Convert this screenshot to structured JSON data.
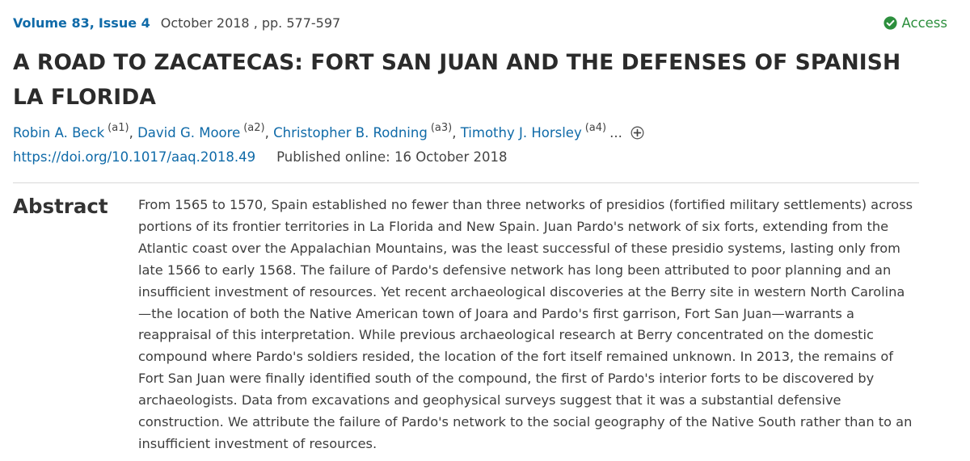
{
  "issue": {
    "volume": "Volume 83",
    "separator": ",",
    "issue": "Issue 4",
    "date_pages": "October 2018 , pp. 577-597"
  },
  "access": {
    "label": "Access",
    "icon": "check-circle-icon",
    "color": "#2c8f3d"
  },
  "article": {
    "title": "A ROAD TO ZACATECAS: FORT SAN JUAN AND THE DEFENSES OF SPANISH LA FLORIDA"
  },
  "authors": [
    {
      "name": "Robin A. Beck",
      "aff": "(a1)"
    },
    {
      "name": "David G. Moore",
      "aff": "(a2)"
    },
    {
      "name": "Christopher B. Rodning",
      "aff": "(a3)"
    },
    {
      "name": "Timothy J. Horsley",
      "aff": "(a4)"
    }
  ],
  "authors_more": "...",
  "doi": {
    "url": "https://doi.org/10.1017/aaq.2018.49",
    "published": "Published online: 16 October 2018"
  },
  "abstract": {
    "heading": "Abstract",
    "text": "From 1565 to 1570, Spain established no fewer than three networks of presidios (fortified military settlements) across portions of its frontier territories in La Florida and New Spain. Juan Pardo's network of six forts, extending from the Atlantic coast over the Appalachian Mountains, was the least successful of these presidio systems, lasting only from late 1566 to early 1568. The failure of Pardo's defensive network has long been attributed to poor planning and an insufficient investment of resources. Yet recent archaeological discoveries at the Berry site in western North Carolina—the location of both the Native American town of Joara and Pardo's first garrison, Fort San Juan—warrants a reappraisal of this interpretation. While previous archaeological research at Berry concentrated on the domestic compound where Pardo's soldiers resided, the location of the fort itself remained unknown. In 2013, the remains of Fort San Juan were finally identified south of the compound, the first of Pardo's interior forts to be discovered by archaeologists. Data from excavations and geophysical surveys suggest that it was a substantial defensive construction. We attribute the failure of Pardo's network to the social geography of the Native South rather than to an insufficient investment of resources."
  },
  "colors": {
    "link": "#0f6aa8",
    "text": "#333333"
  }
}
